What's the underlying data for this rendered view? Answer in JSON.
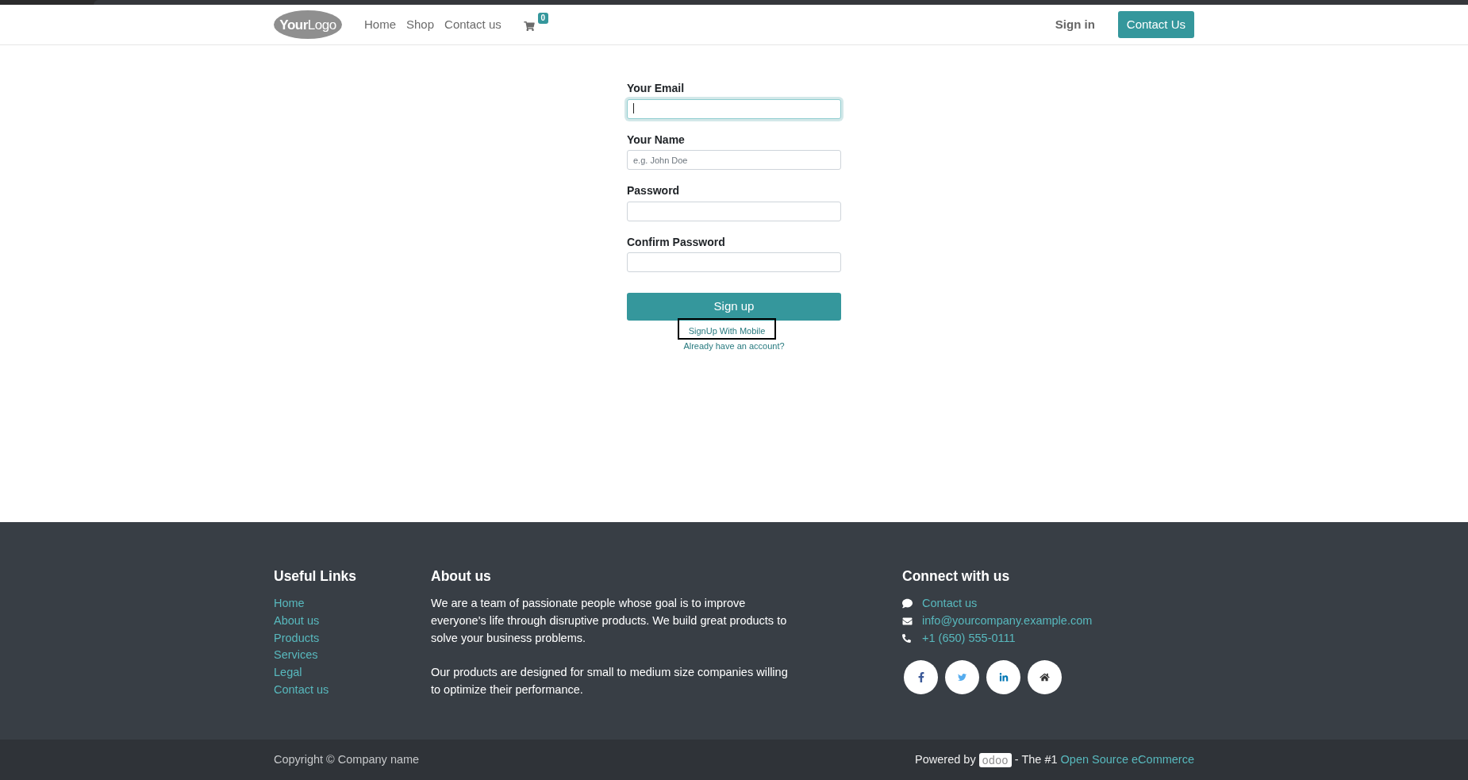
{
  "header": {
    "logo": "**Your**Logo",
    "nav": [
      {
        "label": "Home"
      },
      {
        "label": "Shop"
      },
      {
        "label": "Contact us"
      }
    ],
    "cart": {
      "count": "0"
    },
    "sign_in": "Sign in",
    "contact_button": "Contact Us"
  },
  "signup_form": {
    "fields": [
      {
        "label": "Your Email",
        "focused": true
      },
      {
        "label": "Your Name",
        "placeholder": "e.g. John Doe",
        "focused": false
      },
      {
        "label": "Password",
        "focused": false
      },
      {
        "label": "Confirm Password",
        "focused": false
      }
    ],
    "submit": "Sign up",
    "mobile_link": {
      "label": "SignUp With Mobile",
      "outlined": true
    },
    "login_link": "Already have an account?"
  },
  "footer": {
    "useful_links": {
      "title": "Useful Links",
      "links": [
        "Home",
        "About us",
        "Products",
        "Services",
        "Legal",
        "Contact us"
      ]
    },
    "about": {
      "title": "About us",
      "paragraphs": [
        "We are a team of passionate people whose goal is to improve everyone's life through disruptive products. We build great products to solve your business problems.",
        "Our products are designed for small to medium size companies willing to optimize their performance."
      ]
    },
    "connect": {
      "title": "Connect with us",
      "contacts": [
        {
          "kind": "chat",
          "label": "Contact us"
        },
        {
          "kind": "email",
          "label": "info@yourcompany.example.com"
        },
        {
          "kind": "phone",
          "label": "+1 (650) 555-0111"
        }
      ],
      "social": [
        {
          "kind": "facebook"
        },
        {
          "kind": "twitter"
        },
        {
          "kind": "linkedin"
        },
        {
          "kind": "home"
        }
      ]
    }
  },
  "bottom_bar": {
    "copyright": "Copyright © Company name",
    "powered_by": {
      "prefix": "Powered by",
      "logo": "odoo",
      "suffix": "- The #1",
      "link": "Open Source eCommerce"
    }
  }
}
